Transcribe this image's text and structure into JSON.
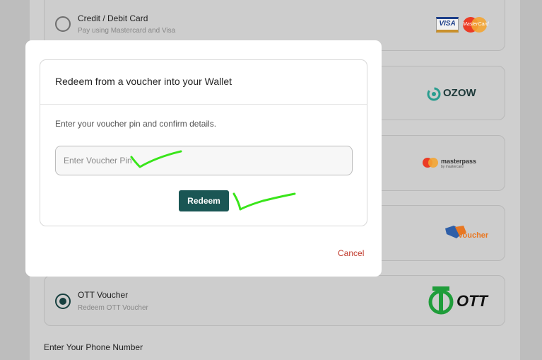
{
  "payment_options": [
    {
      "title": "Credit / Debit Card",
      "subtitle": "Pay using Mastercard and Visa",
      "logo": "visa-mastercard-logo",
      "selected": false
    },
    {
      "title": "",
      "subtitle": "",
      "logo": "ozow-logo",
      "selected": false
    },
    {
      "title": "",
      "subtitle": "",
      "logo": "masterpass-logo",
      "selected": false
    },
    {
      "title": "",
      "subtitle": "",
      "logo": "voucher-logo",
      "selected": false
    },
    {
      "title": "OTT Voucher",
      "subtitle": "Redeem OTT Voucher",
      "logo": "ott-logo",
      "selected": true
    }
  ],
  "logos": {
    "visa": "VISA",
    "mastercard": "MasterCard",
    "ozow": "OZOW",
    "masterpass": "masterpass",
    "masterpass_sub": "by mastercard",
    "voucher": "Voucher",
    "ott": "OTT"
  },
  "phone_label": "Enter Your Phone Number",
  "modal": {
    "title": "Redeem from a voucher into your Wallet",
    "instructions": "Enter your voucher pin and confirm details.",
    "pin_placeholder": "Enter Voucher Pin",
    "pin_value": "",
    "redeem_label": "Redeem",
    "cancel_label": "Cancel"
  },
  "colors": {
    "accent": "#1a5654",
    "cancel": "#c0392b",
    "annotation": "#39e51a"
  }
}
